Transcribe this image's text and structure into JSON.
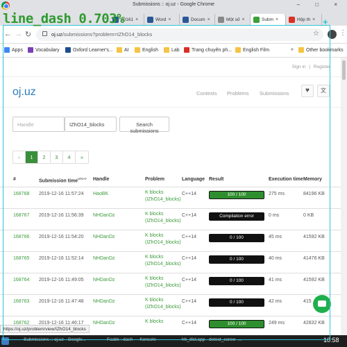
{
  "overlay": {
    "label": "line_dash 0.703%"
  },
  "window": {
    "title": "Submissions :: oj.uz - Google Chrome",
    "controls": "–  □  ×"
  },
  "tabs": [
    {
      "label": "20161",
      "color": "#2b5797"
    },
    {
      "label": "Word",
      "color": "#2b5797"
    },
    {
      "label": "Docum",
      "color": "#2b5797"
    },
    {
      "label": "Một số",
      "color": "#888888"
    },
    {
      "label": "Subm",
      "color": "#3aa03a"
    },
    {
      "label": "Hộp th",
      "color": "#d93025"
    }
  ],
  "address": {
    "domain": "oj.uz",
    "path": "/submissions?problem=IZhO14_blocks"
  },
  "bookmarks": [
    {
      "label": "Apps",
      "icon": "apps-icon"
    },
    {
      "label": "Vocabulary",
      "icon": "v-icon"
    },
    {
      "label": "Oxford Learner's...",
      "icon": "oxford-icon"
    },
    {
      "label": "AI",
      "icon": "folder-icon"
    },
    {
      "label": "English",
      "icon": "folder-icon"
    },
    {
      "label": "Lab",
      "icon": "folder-icon"
    },
    {
      "label": "Trang chuyên ph...",
      "icon": "t-icon"
    },
    {
      "label": "English Film",
      "icon": "folder-icon"
    }
  ],
  "bookmarks_more": "»",
  "other_bookmarks": "Other bookmarks",
  "page": {
    "signin": "Sign in",
    "separator": "|",
    "register": "Register",
    "logo": "oj.uz",
    "nav": {
      "contests": "Contests",
      "problems": "Problems",
      "submissions": "Submissions"
    },
    "search": {
      "handle_placeholder": "Handle",
      "problem_value": "IZhO14_blocks",
      "button": "Search submissions"
    },
    "pager": {
      "prev": "«",
      "pages": [
        "1",
        "2",
        "3",
        "4"
      ],
      "next": "»",
      "current": "1"
    },
    "headers": {
      "id": "#",
      "time": "Submission time",
      "time_sup": "UTC+7",
      "handle": "Handle",
      "problem": "Problem",
      "language": "Language",
      "result": "Result",
      "exec": "Execution time",
      "memory": "Memory"
    },
    "rows": [
      {
        "id": "168768",
        "time": "2019-12-16 11:57:24",
        "handle": "HaoBK",
        "problem1": "K blocks",
        "problem2": "(IZhO14_blocks)",
        "lang": "C++14",
        "result": "100 / 100",
        "accepted": true,
        "exec": "275 ms",
        "mem": "84196 KB"
      },
      {
        "id": "168767",
        "time": "2019-12-16 11:56:39",
        "handle": "NHDanDz",
        "problem1": "K blocks",
        "problem2": "(IZhO14_blocks)",
        "lang": "C++14",
        "result": "Compilation error",
        "accepted": false,
        "exec": "0 ms",
        "mem": "0 KB"
      },
      {
        "id": "168766",
        "time": "2019-12-16 11:54:20",
        "handle": "NHDanDz",
        "problem1": "K blocks",
        "problem2": "(IZhO14_blocks)",
        "lang": "C++14",
        "result": "0 / 100",
        "accepted": false,
        "exec": "45 ms",
        "mem": "41592 KB"
      },
      {
        "id": "168765",
        "time": "2019-12-16 11:52:14",
        "handle": "NHDanDz",
        "problem1": "K blocks",
        "problem2": "(IZhO14_blocks)",
        "lang": "C++14",
        "result": "0 / 100",
        "accepted": false,
        "exec": "40 ms",
        "mem": "41476 KB"
      },
      {
        "id": "168764",
        "time": "2019-12-16 11:49:05",
        "handle": "NHDanDz",
        "problem1": "K blocks",
        "problem2": "(IZhO14_blocks)",
        "lang": "C++14",
        "result": "0 / 100",
        "accepted": false,
        "exec": "41 ms",
        "mem": "41592 KB"
      },
      {
        "id": "168763",
        "time": "2019-12-16 11:47:48",
        "handle": "NHDanDz",
        "problem1": "K blocks",
        "problem2": "(IZhO14_blocks)",
        "lang": "C++14",
        "result": "0 / 100",
        "accepted": false,
        "exec": "42 ms",
        "mem": "415"
      },
      {
        "id": "168762",
        "time": "2019-12-16 11:46:17",
        "handle": "NHDanDz",
        "problem1": "K blocks",
        "problem2": "",
        "lang": "C++14",
        "result": "100 / 100",
        "accepted": true,
        "exec": "249 ms",
        "mem": "42832 KB"
      }
    ]
  },
  "status_url": "https://oj.uz/problem/view/IZhO14_blocks",
  "taskbar": {
    "items": [
      "Submissions :: oj.uz - Google...",
      "Facbk : dash — Konsole",
      "hh_dist.cpp - detect_screw -..."
    ],
    "clock": "10:58"
  }
}
